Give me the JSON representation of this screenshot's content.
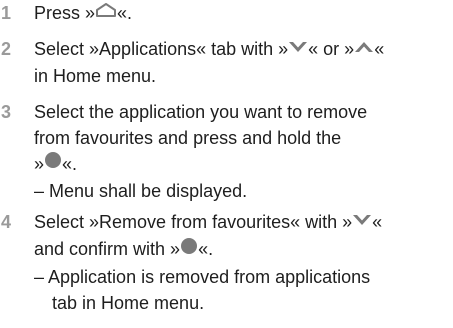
{
  "steps": [
    {
      "number": "1",
      "text_before": "Press »",
      "icon": "home-icon",
      "text_after": "«."
    },
    {
      "number": "2",
      "line1_a": "Select »Applications« tab with »",
      "icon1": "chevron-down-icon",
      "line1_b": "« or »",
      "icon2": "chevron-up-icon",
      "line1_c": "«",
      "line2": "in Home menu."
    },
    {
      "number": "3",
      "line1": "Select the application you want to remove",
      "line2": "from favourites and press and hold the",
      "line3_a": "»",
      "icon": "ok-button-icon",
      "line3_b": "«.",
      "result": "– Menu shall be displayed."
    },
    {
      "number": "4",
      "line1_a": "Select »Remove from favourites« with »",
      "icon1": "chevron-down-icon",
      "line1_b": "«",
      "line2_a": "and confirm with »",
      "icon2": "ok-button-icon",
      "line2_b": "«.",
      "result_line1": "– Application is removed from applications",
      "result_line2": "tab in Home menu."
    }
  ],
  "colors": {
    "text": "#1e1e1e",
    "step_number": "#9a9a9a",
    "icon": "#7a7a7a"
  }
}
